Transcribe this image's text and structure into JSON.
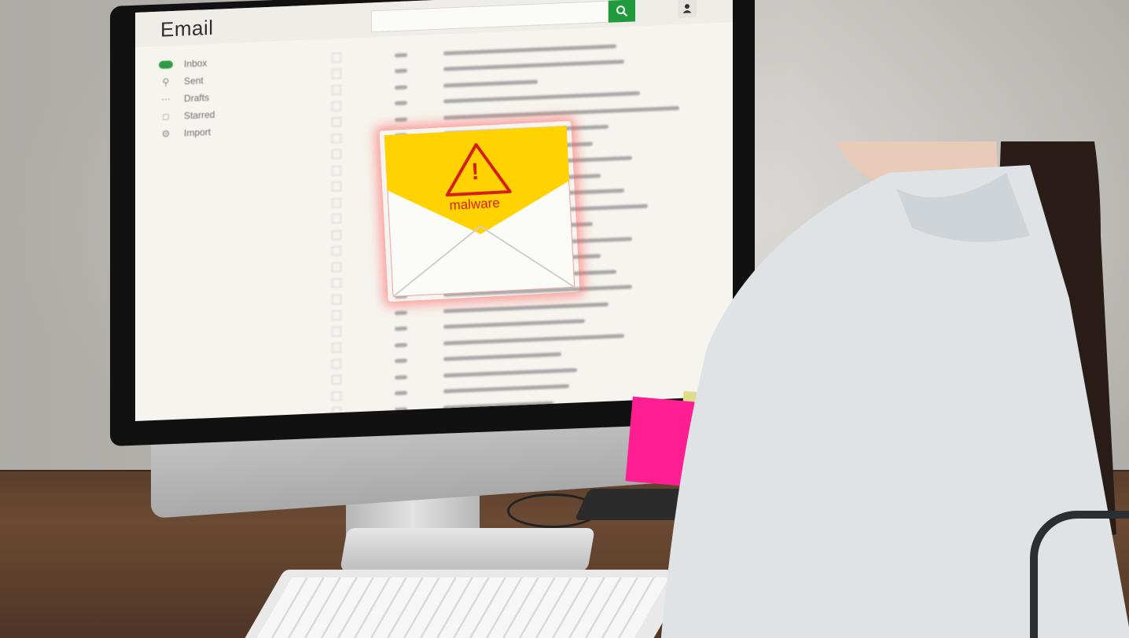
{
  "app": {
    "title": "Email"
  },
  "sidebar": {
    "items": [
      {
        "label": "Inbox",
        "icon": "inbox-icon"
      },
      {
        "label": "Sent",
        "icon": "search-icon"
      },
      {
        "label": "Drafts",
        "icon": "draft-icon"
      },
      {
        "label": "Starred",
        "icon": "star-icon"
      },
      {
        "label": "Import",
        "icon": "gear-icon"
      }
    ]
  },
  "alert": {
    "label": "malware",
    "icon": "warning-triangle-icon"
  },
  "colors": {
    "accent": "#1f9a3c",
    "warning": "#d41f1f",
    "envelope_flap": "#ffd200"
  }
}
